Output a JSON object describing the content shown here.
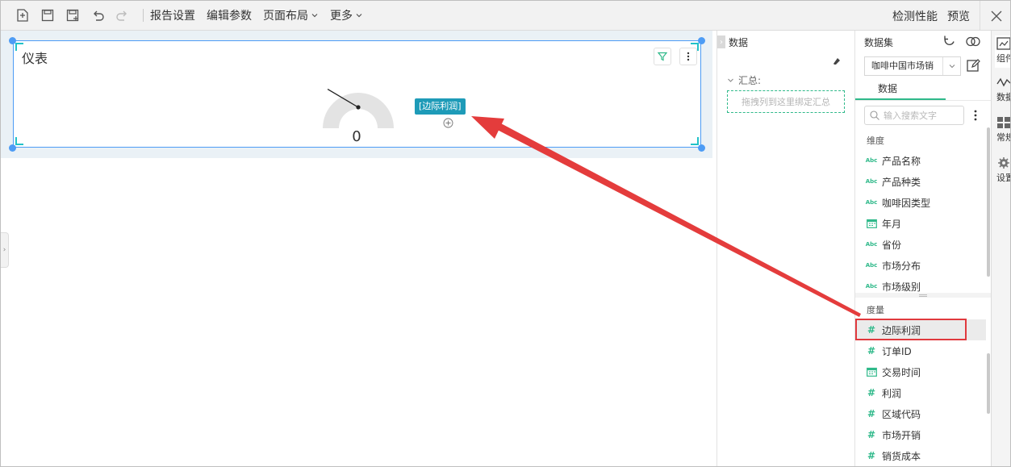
{
  "toolbar": {
    "icons": [
      "new-report-icon",
      "save-icon",
      "save-as-icon",
      "undo-icon",
      "redo-icon"
    ],
    "menus": [
      {
        "label": "报告设置",
        "has_caret": false
      },
      {
        "label": "编辑参数",
        "has_caret": false
      },
      {
        "label": "页面布局",
        "has_caret": true
      },
      {
        "label": "更多",
        "has_caret": true
      }
    ],
    "detect_label": "检测性能",
    "preview_label": "预览",
    "close_icon": "close-icon"
  },
  "widget": {
    "title": "仪表",
    "gauge_value": "0",
    "gauge_value_fraction": 0,
    "field_tag": "[边际利润]",
    "filter_icon": "filter-icon",
    "more_icon": "more-vertical-icon",
    "add_icon": "add-circle-icon"
  },
  "data_panel": {
    "title": "数据",
    "summary_label": "汇总:",
    "drop_placeholder": "拖拽列到这里绑定汇总"
  },
  "fields_panel": {
    "dataset_label": "数据集",
    "dataset_value": "咖啡中国市场销",
    "tab_label": "数据",
    "search_placeholder": "输入搜索文字",
    "dimension_label": "维度",
    "measure_label": "度量",
    "dimensions": [
      {
        "icon": "abc",
        "label": "产品名称"
      },
      {
        "icon": "abc",
        "label": "产品种类"
      },
      {
        "icon": "abc",
        "label": "咖啡因类型"
      },
      {
        "icon": "calendar",
        "label": "年月"
      },
      {
        "icon": "abc",
        "label": "省份"
      },
      {
        "icon": "abc",
        "label": "市场分布"
      },
      {
        "icon": "abc",
        "label": "市场级别"
      }
    ],
    "measures": [
      {
        "icon": "hash",
        "label": "边际利润",
        "selected": true
      },
      {
        "icon": "hash",
        "label": "订单ID"
      },
      {
        "icon": "calendar",
        "label": "交易时间"
      },
      {
        "icon": "hash",
        "label": "利润"
      },
      {
        "icon": "hash",
        "label": "区域代码"
      },
      {
        "icon": "hash",
        "label": "市场开销"
      },
      {
        "icon": "hash",
        "label": "销货成本"
      }
    ]
  },
  "right_tabs": [
    {
      "label": "组件",
      "icon": "component-icon"
    },
    {
      "label": "数据",
      "icon": "data-icon"
    },
    {
      "label": "常规",
      "icon": "grid-icon"
    },
    {
      "label": "设置",
      "icon": "gear-icon"
    }
  ],
  "colors": {
    "accent": "#2fb98a",
    "selection": "#4d9cf5",
    "tag": "#1e9bb8",
    "annotation": "#e0393e"
  }
}
